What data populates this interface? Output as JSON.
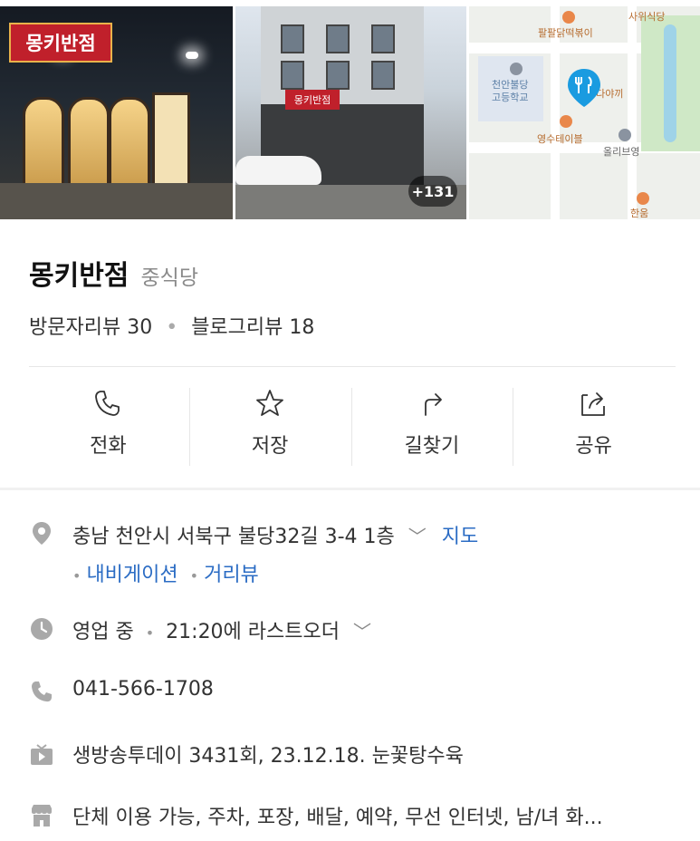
{
  "gallery": {
    "photo1_sign": "몽키반점",
    "photo2_sign": "몽키반점",
    "more_count": "+131",
    "map_labels": {
      "label1": "사위식당",
      "label2": "팔팔닭떡볶이",
      "label3": "천안불당",
      "label4": "고등학교",
      "label5": "바다야끼",
      "label6": "영수테이블",
      "label7": "올리브영",
      "label8": "한움"
    }
  },
  "place": {
    "name": "몽키반점",
    "category": "중식당",
    "visitor_review_label": "방문자리뷰",
    "visitor_review_count": "30",
    "blog_review_label": "블로그리뷰",
    "blog_review_count": "18"
  },
  "actions": [
    {
      "label": "전화",
      "icon": "phone-icon"
    },
    {
      "label": "저장",
      "icon": "star-icon"
    },
    {
      "label": "길찾기",
      "icon": "directions-icon"
    },
    {
      "label": "공유",
      "icon": "share-icon"
    }
  ],
  "info": {
    "address": "충남 천안시 서북구 불당32길 3-4 1층",
    "map_link": "지도",
    "navigation_link": "내비게이션",
    "streetview_link": "거리뷰",
    "status": "영업 중",
    "last_order": "21:20에 라스트오더",
    "phone": "041-566-1708",
    "tv": "생방송투데이 3431회, 23.12.18. 눈꽃탕수육",
    "amenities": "단체 이용 가능, 주차, 포장, 배달, 예약, 무선 인터넷, 남/녀 화..."
  },
  "colors": {
    "accent_link": "#2b6cc4",
    "map_pin": "#1a9be0",
    "icon_gray": "#9a9a9a"
  }
}
